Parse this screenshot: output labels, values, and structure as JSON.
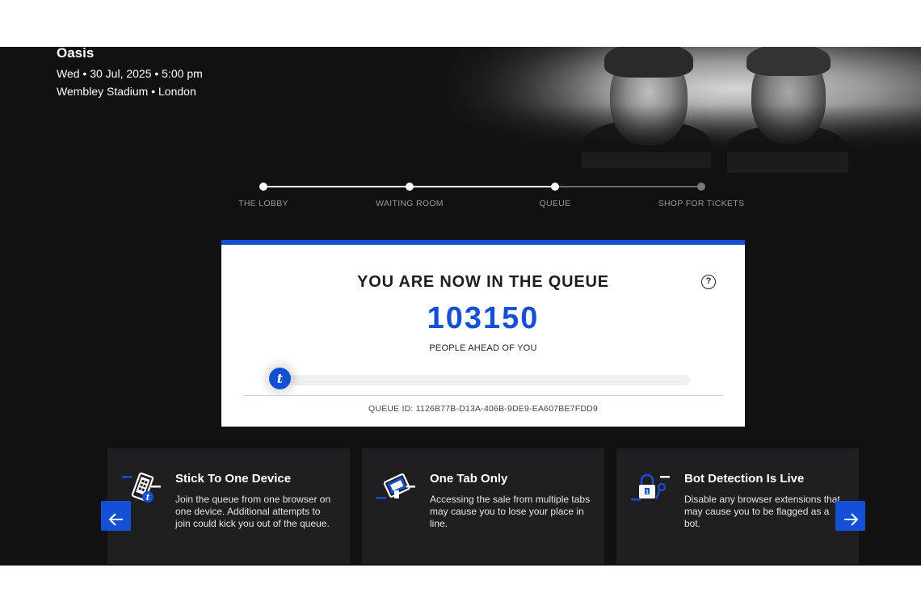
{
  "event": {
    "artist": "Oasis",
    "datetime": "Wed • 30 Jul, 2025 • 5:00 pm",
    "venue": "Wembley Stadium • London"
  },
  "steps": [
    {
      "label": "THE LOBBY",
      "state": "done"
    },
    {
      "label": "WAITING ROOM",
      "state": "done"
    },
    {
      "label": "QUEUE",
      "state": "current"
    },
    {
      "label": "SHOP FOR TICKETS",
      "state": "upcoming"
    }
  ],
  "queue": {
    "title": "YOU ARE NOW IN THE QUEUE",
    "help_icon": "question-mark-icon",
    "people_ahead": "103150",
    "people_ahead_label": "PEOPLE AHEAD OF YOU",
    "progress_fraction": 0.03,
    "progress_badge": "t",
    "queue_id": "QUEUE ID: 1126B77B-D13A-406B-9DE9-EA607BE7FDD9"
  },
  "tips": [
    {
      "icon": "phone-device-icon",
      "title": "Stick To One Device",
      "text": "Join the queue from one browser on one device. Additional attempts to join could kick you out of the queue."
    },
    {
      "icon": "tabs-icon",
      "title": "One Tab Only",
      "text": "Accessing the sale from multiple tabs may cause you to lose your place in line."
    },
    {
      "icon": "lock-key-icon",
      "title": "Bot Detection Is Live",
      "text": "Disable any browser extensions that may cause you to be flagged as a bot."
    }
  ],
  "carousel": {
    "prev_icon": "arrow-left-icon",
    "next_icon": "arrow-right-icon"
  },
  "colors": {
    "accent": "#1450d6",
    "background": "#111112",
    "card": "#ffffff",
    "tip_card": "#1f1f21"
  }
}
